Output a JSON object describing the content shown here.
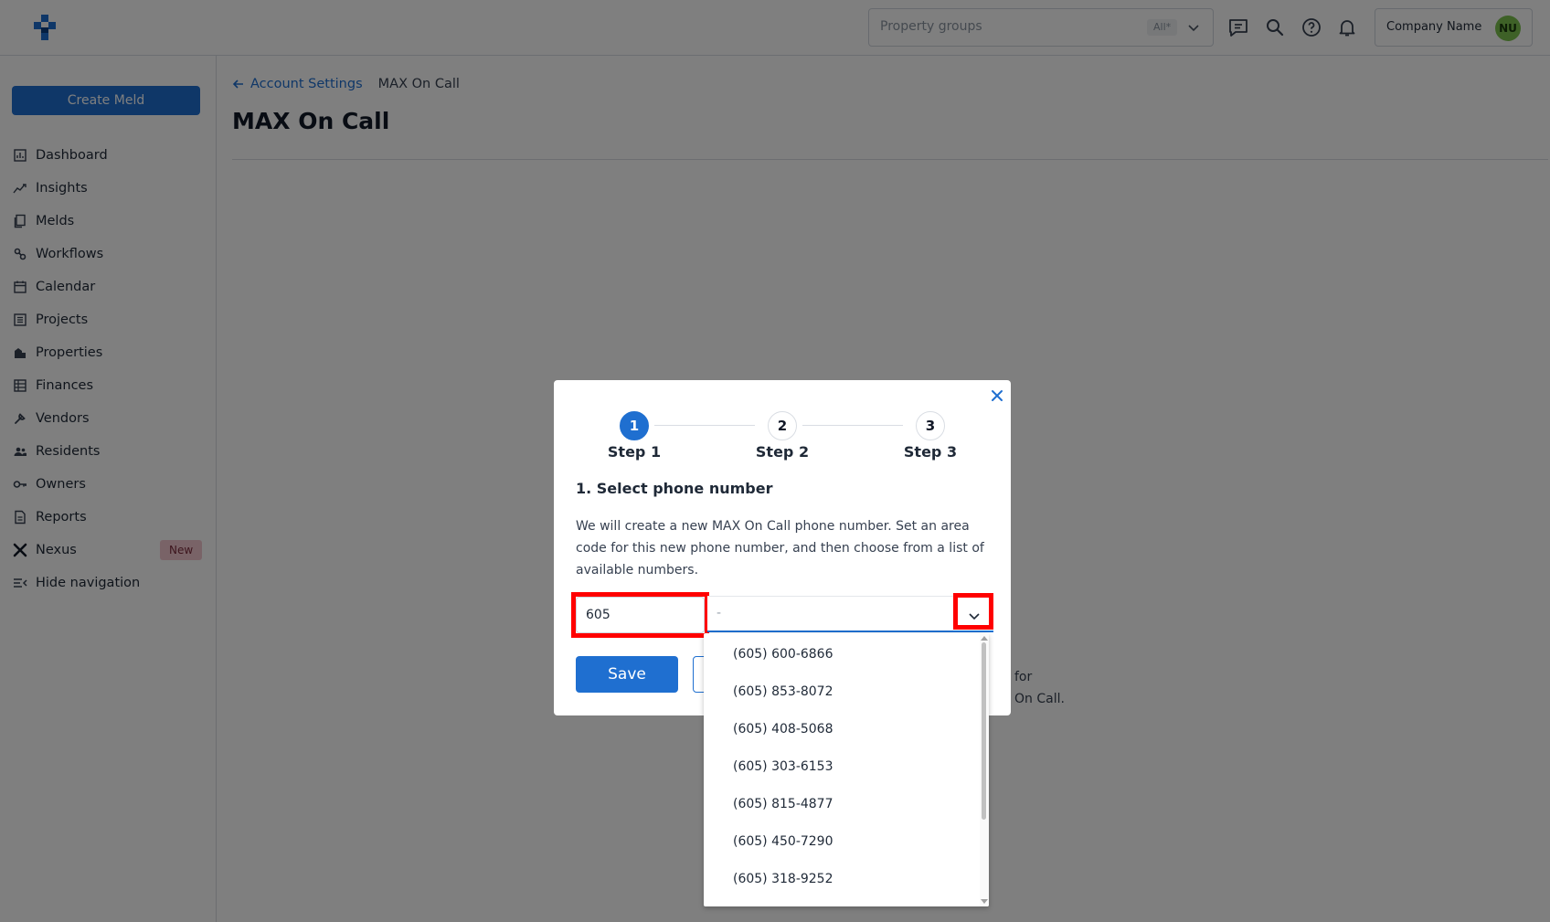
{
  "topbar": {
    "property_groups_placeholder": "Property groups",
    "property_groups_badge": "All*",
    "company_name": "Company Name",
    "avatar_initials": "NU"
  },
  "sidebar": {
    "create_button": "Create Meld",
    "items": [
      {
        "label": "Dashboard",
        "icon": "dashboard-icon"
      },
      {
        "label": "Insights",
        "icon": "insights-icon"
      },
      {
        "label": "Melds",
        "icon": "melds-icon"
      },
      {
        "label": "Workflows",
        "icon": "workflows-icon"
      },
      {
        "label": "Calendar",
        "icon": "calendar-icon"
      },
      {
        "label": "Projects",
        "icon": "projects-icon"
      },
      {
        "label": "Properties",
        "icon": "properties-icon"
      },
      {
        "label": "Finances",
        "icon": "finances-icon"
      },
      {
        "label": "Vendors",
        "icon": "vendors-icon"
      },
      {
        "label": "Residents",
        "icon": "residents-icon"
      },
      {
        "label": "Owners",
        "icon": "owners-icon"
      },
      {
        "label": "Reports",
        "icon": "reports-icon"
      },
      {
        "label": "Nexus",
        "icon": "nexus-icon",
        "badge": "New"
      },
      {
        "label": "Hide navigation",
        "icon": "hide-navigation-icon"
      }
    ]
  },
  "breadcrumb": {
    "back_label": "Account Settings",
    "current": "MAX On Call"
  },
  "page": {
    "title": "MAX On Call",
    "background_text_line1": "for",
    "background_text_line2": "On Call."
  },
  "modal": {
    "steps": [
      {
        "number": "1",
        "label": "Step 1",
        "active": true
      },
      {
        "number": "2",
        "label": "Step 2",
        "active": false
      },
      {
        "number": "3",
        "label": "Step 3",
        "active": false
      }
    ],
    "section_title": "1. Select phone number",
    "description": "We will create a new MAX On Call phone number. Set an area code for this new phone number, and then choose from a list of available numbers.",
    "area_code_value": "605",
    "number_select_value": "-",
    "save_label": "Save"
  },
  "dropdown": {
    "options": [
      "(605) 600-6866",
      "(605) 853-8072",
      "(605) 408-5068",
      "(605) 303-6153",
      "(605) 815-4877",
      "(605) 450-7290",
      "(605) 318-9252"
    ]
  },
  "colors": {
    "accent": "#1f6fd0",
    "highlight": "#ff0000",
    "avatar": "#7cc24e",
    "new_badge": "#f3c6cf"
  }
}
